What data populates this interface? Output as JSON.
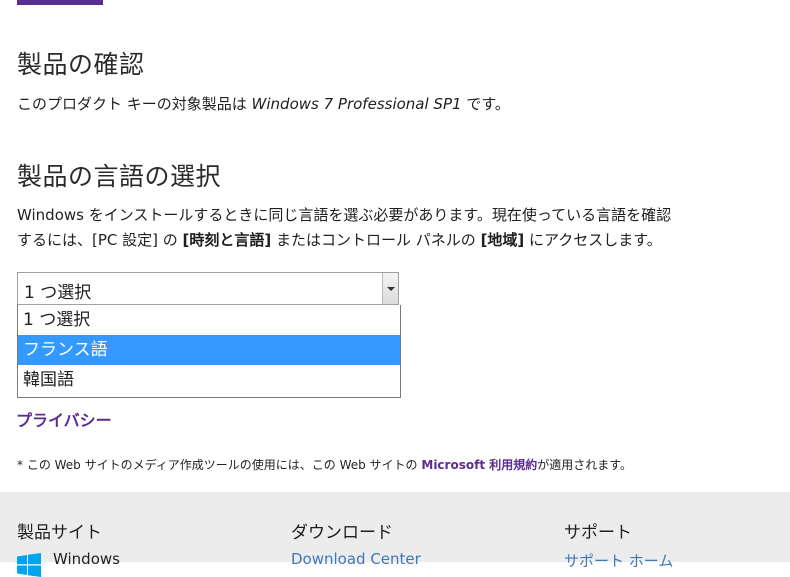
{
  "headings": {
    "confirm": "製品の確認",
    "language": "製品の言語の選択"
  },
  "confirm": {
    "prefix": "このプロダクト キーの対象製品は ",
    "product": "Windows 7 Professional SP1",
    "suffix": " です。"
  },
  "lang_desc": {
    "line1": "Windows をインストールするときに同じ言語を選ぶ必要があります。現在使っている言語を確認",
    "line2a": "するには、[PC 設定] の ",
    "bold1": "[時刻と言語]",
    "line2b": " またはコントロール パネルの ",
    "bold2": "[地域]",
    "line2c": " にアクセスします。"
  },
  "select": {
    "value": "1 つ選択",
    "options": [
      "1 つ選択",
      "フランス語",
      "韓国語"
    ],
    "highlighted_index": 1
  },
  "privacy_label": "プライバシー",
  "footnote": {
    "prefix": "* この Web サイトのメディア作成ツールの使用には、この Web サイトの ",
    "link": "Microsoft 利用規約",
    "suffix": "が適用されます。"
  },
  "footer": {
    "col1": {
      "heading": "製品サイト",
      "link": "Windows"
    },
    "col2": {
      "heading": "ダウンロード",
      "link": "Download Center"
    },
    "col3": {
      "heading": "サポート",
      "link": "サポート ホーム"
    }
  },
  "colors": {
    "accent": "#5c2d91",
    "highlight": "#3399ff",
    "footer_bg": "#ececec",
    "footer_link": "#3e78b8"
  },
  "icons": [
    "windows-logo-icon",
    "dropdown-arrow-icon"
  ]
}
